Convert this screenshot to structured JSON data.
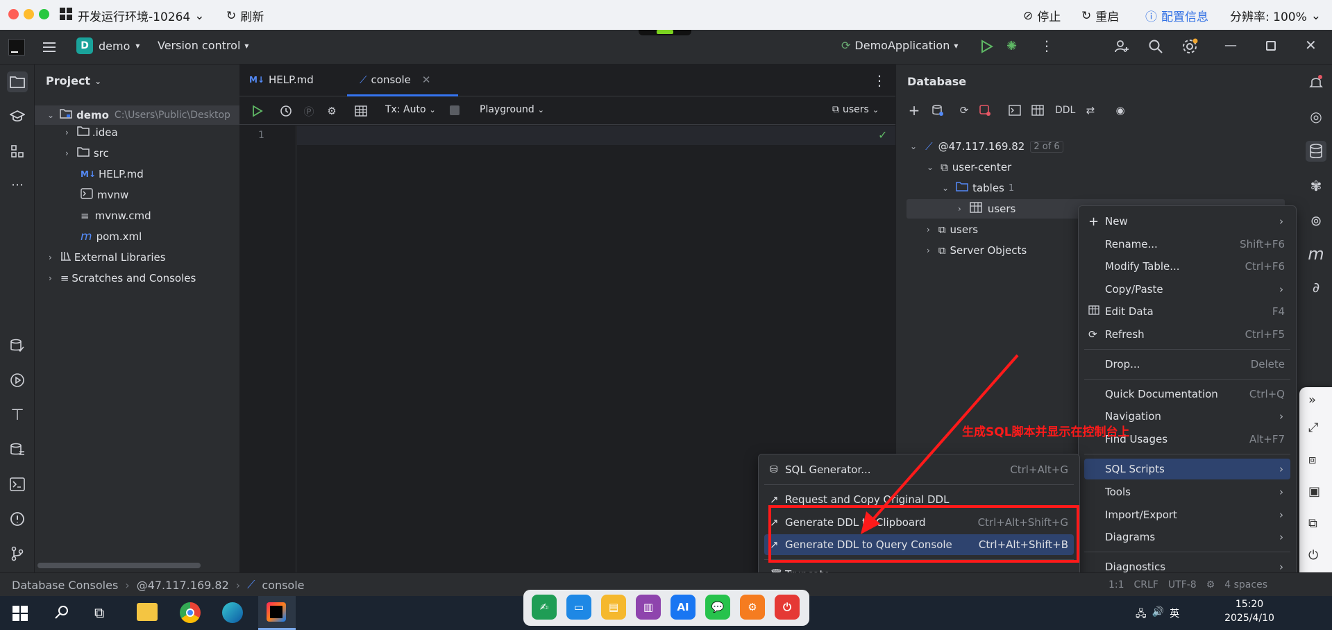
{
  "top_bar": {
    "env_title": "开发运行环境-10264",
    "refresh": "刷新",
    "stop": "停止",
    "restart": "重启",
    "config": "配置信息",
    "resolution": "分辨率: 100%"
  },
  "header": {
    "project_badge": "D",
    "project_name": "demo",
    "vcs": "Version control",
    "run_config": "DemoApplication"
  },
  "project_panel": {
    "title": "Project",
    "root_name": "demo",
    "root_path": "C:\\Users\\Public\\Desktop",
    "items": [
      {
        "label": ".idea"
      },
      {
        "label": "src"
      },
      {
        "label": "HELP.md"
      },
      {
        "label": "mvnw"
      },
      {
        "label": "mvnw.cmd"
      },
      {
        "label": "pom.xml"
      },
      {
        "label": "External Libraries"
      },
      {
        "label": "Scratches and Consoles"
      }
    ]
  },
  "editor": {
    "tabs": [
      {
        "label": "HELP.md"
      },
      {
        "label": "console"
      }
    ],
    "tx_mode": "Tx: Auto",
    "playground": "Playground",
    "schema": "users",
    "line_number": "1"
  },
  "database": {
    "title": "Database",
    "ddl_label": "DDL",
    "connection": "@47.117.169.82",
    "connection_badge": "2 of 6",
    "schema_user_center": "user-center",
    "tables_label": "tables",
    "tables_count": "1",
    "table_users": "users",
    "schema_users": "users",
    "server_objects": "Server Objects"
  },
  "context_menu": {
    "items": [
      {
        "label": "New",
        "shortcut": ""
      },
      {
        "label": "Rename...",
        "shortcut": "Shift+F6"
      },
      {
        "label": "Modify Table...",
        "shortcut": "Ctrl+F6"
      },
      {
        "label": "Copy/Paste",
        "shortcut": ""
      },
      {
        "label": "Edit Data",
        "shortcut": "F4"
      },
      {
        "label": "Refresh",
        "shortcut": "Ctrl+F5"
      },
      {
        "label": "Drop...",
        "shortcut": "Delete"
      },
      {
        "label": "Quick Documentation",
        "shortcut": "Ctrl+Q"
      },
      {
        "label": "Navigation",
        "shortcut": ""
      },
      {
        "label": "Find Usages",
        "shortcut": "Alt+F7"
      },
      {
        "label": "SQL Scripts",
        "shortcut": ""
      },
      {
        "label": "Tools",
        "shortcut": ""
      },
      {
        "label": "Import/Export",
        "shortcut": ""
      },
      {
        "label": "Diagrams",
        "shortcut": ""
      },
      {
        "label": "Diagnostics",
        "shortcut": ""
      }
    ]
  },
  "submenu": {
    "items": [
      {
        "label": "SQL Generator...",
        "shortcut": "Ctrl+Alt+G"
      },
      {
        "label": "Request and Copy Original DDL",
        "shortcut": ""
      },
      {
        "label": "Generate DDL to Clipboard",
        "shortcut": "Ctrl+Alt+Shift+G"
      },
      {
        "label": "Generate DDL to Query Console",
        "shortcut": "Ctrl+Alt+Shift+B"
      },
      {
        "label": "Truncate...",
        "shortcut": ""
      }
    ]
  },
  "annotation": {
    "text": "生成SQL脚本并显示在控制台上",
    "color": "#ff1a1a"
  },
  "status_bar": {
    "crumb1": "Database Consoles",
    "crumb2": "@47.117.169.82",
    "crumb3": "console",
    "position": "1:1",
    "line_sep": "CRLF",
    "encoding": "UTF-8",
    "indent": "4 spaces"
  },
  "taskbar": {
    "ime": "英",
    "time": "15:20",
    "date": "2025/4/10",
    "dock_ai": "AI"
  },
  "colors": {
    "accent": "#3574f0",
    "selection": "#2e436e",
    "annotation_red": "#ff1a1a"
  }
}
